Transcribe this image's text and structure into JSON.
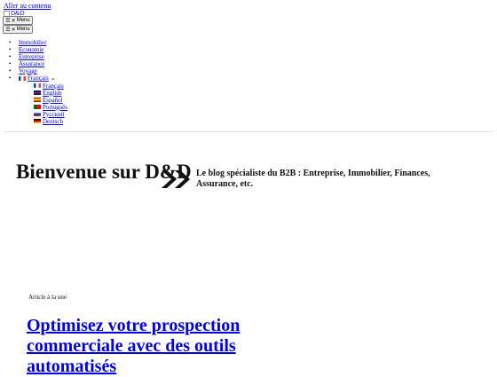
{
  "header": {
    "skip_link": "Aller au contenu",
    "logo_alt": "D&D",
    "menu_label": "Menu",
    "menu_icons": [
      "hamburger-icon",
      "close-icon"
    ]
  },
  "nav": {
    "items": [
      "Immobilier",
      "Economie",
      "Entreprise",
      "Assurance",
      "Voyage"
    ],
    "language": {
      "current": "Français",
      "options": [
        "Français",
        "English",
        "Español",
        "Português",
        "Русский",
        "Deutsch"
      ]
    }
  },
  "hero": {
    "title": "Bienvenue sur D&D",
    "tagline": "Le blog spécialiste du B2B : Entreprise, Immobilier, Finances, Assurance, etc."
  },
  "featured": {
    "label": "Article à la une",
    "title": "Optimisez votre prospection commerciale avec des outils automatisés"
  }
}
